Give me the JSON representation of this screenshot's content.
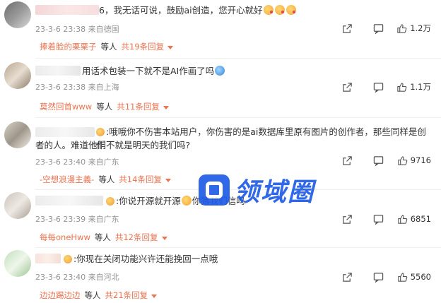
{
  "comments": [
    {
      "text_visible": "6，我无话可说，鼓励ai创造，您开心就好",
      "date": "23-3-6 23:38",
      "location": "来自德国",
      "likes": "1.2万",
      "reply_user": "捧着脸的栗栗子",
      "reply_mid": "等人",
      "reply_count": "共19条回复"
    },
    {
      "text_visible": "用话术包装一下就不是AI作画了吗",
      "date": "23-3-6 23:38",
      "location": "来自上海",
      "likes": "1.1万",
      "reply_user": "莫然回首www",
      "reply_mid": "等人",
      "reply_count": "共11条回复"
    },
    {
      "text_line1": ":哦哦你不伤害本站用户，你伤害的是ai数据库里原有图片的创作者，那些同样是创作",
      "text_line2": "者的人。难道他们不就是明天的我们吗?",
      "date": "23-3-6 23:40",
      "location": "来自广东",
      "likes": "9716",
      "reply_user": "-空想浪漫主義-",
      "reply_mid": "等人",
      "reply_count": "共14条回复"
    },
    {
      "text_visible": ":你说开源就开源",
      "text_after": "你猜我们信吗",
      "date": "23-3-6 23:39",
      "location": "来自广东",
      "likes": "6851",
      "reply_user": "每每oneHww",
      "reply_mid": "等人",
      "reply_count": "共12条回复"
    },
    {
      "text_visible": ":你现在关闭功能兴许还能挽回一点哦",
      "date": "23-3-6 23:40",
      "location": "来自河北",
      "likes": "5560",
      "reply_user": "边边踢边边",
      "reply_mid": "等人",
      "reply_count": "共21条回复"
    }
  ],
  "watermark": {
    "text": "领域圈",
    "color": "#1f5ce6"
  },
  "accent": "#eb7350"
}
